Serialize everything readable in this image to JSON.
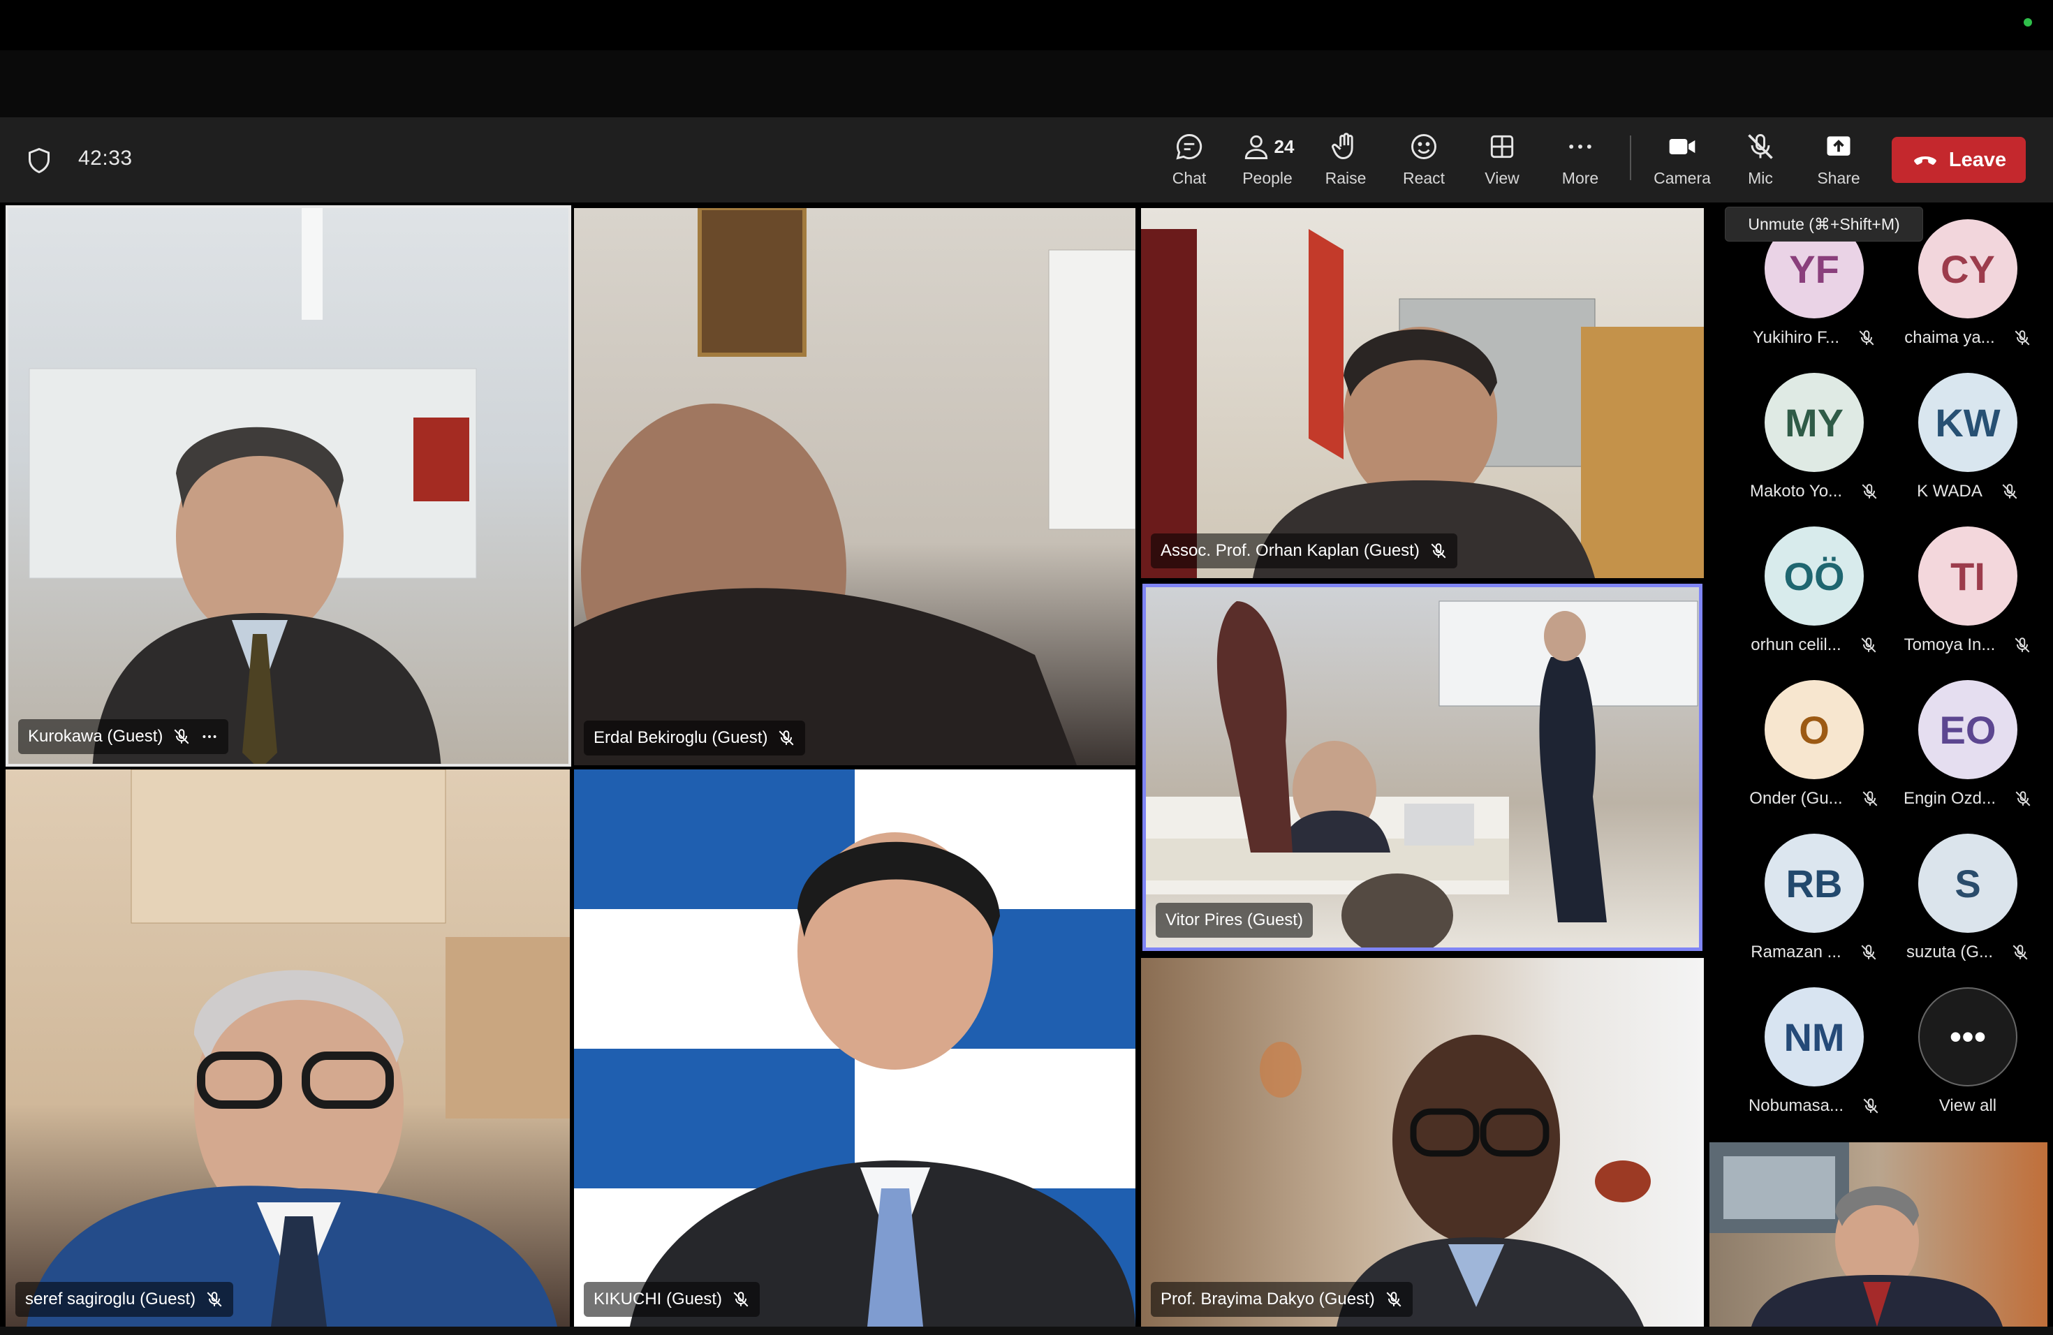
{
  "meeting": {
    "timer": "42:33"
  },
  "toolbar": {
    "chat": "Chat",
    "people": "People",
    "people_count": "24",
    "raise": "Raise",
    "react": "React",
    "view": "View",
    "more": "More",
    "camera": "Camera",
    "mic": "Mic",
    "share": "Share",
    "leave": "Leave"
  },
  "tooltip": {
    "mic": "Unmute (⌘+Shift+M)"
  },
  "tiles": [
    {
      "name": "Kurokawa (Guest)"
    },
    {
      "name": "Erdal Bekiroglu (Guest)"
    },
    {
      "name": "Assoc. Prof. Orhan Kaplan (Guest)"
    },
    {
      "name": "Vitor Pires (Guest)"
    },
    {
      "name": "seref sagiroglu (Guest)"
    },
    {
      "name": "KIKUCHI (Guest)"
    },
    {
      "name": "Prof. Brayima Dakyo (Guest)"
    }
  ],
  "roster": [
    {
      "initials": "YF",
      "name": "Yukihiro F...",
      "color": "#ead3e6",
      "text": "#8a3f7c"
    },
    {
      "initials": "CY",
      "name": "chaima ya...",
      "color": "#f2d6dc",
      "text": "#9c3c4c"
    },
    {
      "initials": "MY",
      "name": "Makoto Yo...",
      "color": "#dfeae4",
      "text": "#2f5b47"
    },
    {
      "initials": "KW",
      "name": "K WADA",
      "color": "#d9e6ef",
      "text": "#275073"
    },
    {
      "initials": "OÖ",
      "name": "orhun celil...",
      "color": "#d8ebec",
      "text": "#1f6670"
    },
    {
      "initials": "TI",
      "name": "Tomoya In...",
      "color": "#f3d7dc",
      "text": "#9c3c4c"
    },
    {
      "initials": "O",
      "name": "Onder (Gu...",
      "color": "#f7e6cf",
      "text": "#9c5a14"
    },
    {
      "initials": "EO",
      "name": "Engin Ozd...",
      "color": "#e5def0",
      "text": "#5c4690"
    },
    {
      "initials": "RB",
      "name": "Ramazan ...",
      "color": "#dce6ef",
      "text": "#22496d"
    },
    {
      "initials": "S",
      "name": "suzuta (G...",
      "color": "#dbe4ec",
      "text": "#2a4c6b"
    },
    {
      "initials": "NM",
      "name": "Nobumasa...",
      "color": "#d8e4f1",
      "text": "#254a78"
    }
  ],
  "view_all": {
    "label": "View all"
  },
  "icons": {
    "shield": "shield-icon",
    "chat": "chat-icon",
    "people": "people-icon",
    "raise": "hand-icon",
    "react": "smiley-icon",
    "view": "grid-icon",
    "more": "ellipsis-icon",
    "camera": "camera-icon",
    "mic": "mic-off-icon",
    "share": "share-icon",
    "leave": "phone-hangup-icon"
  }
}
